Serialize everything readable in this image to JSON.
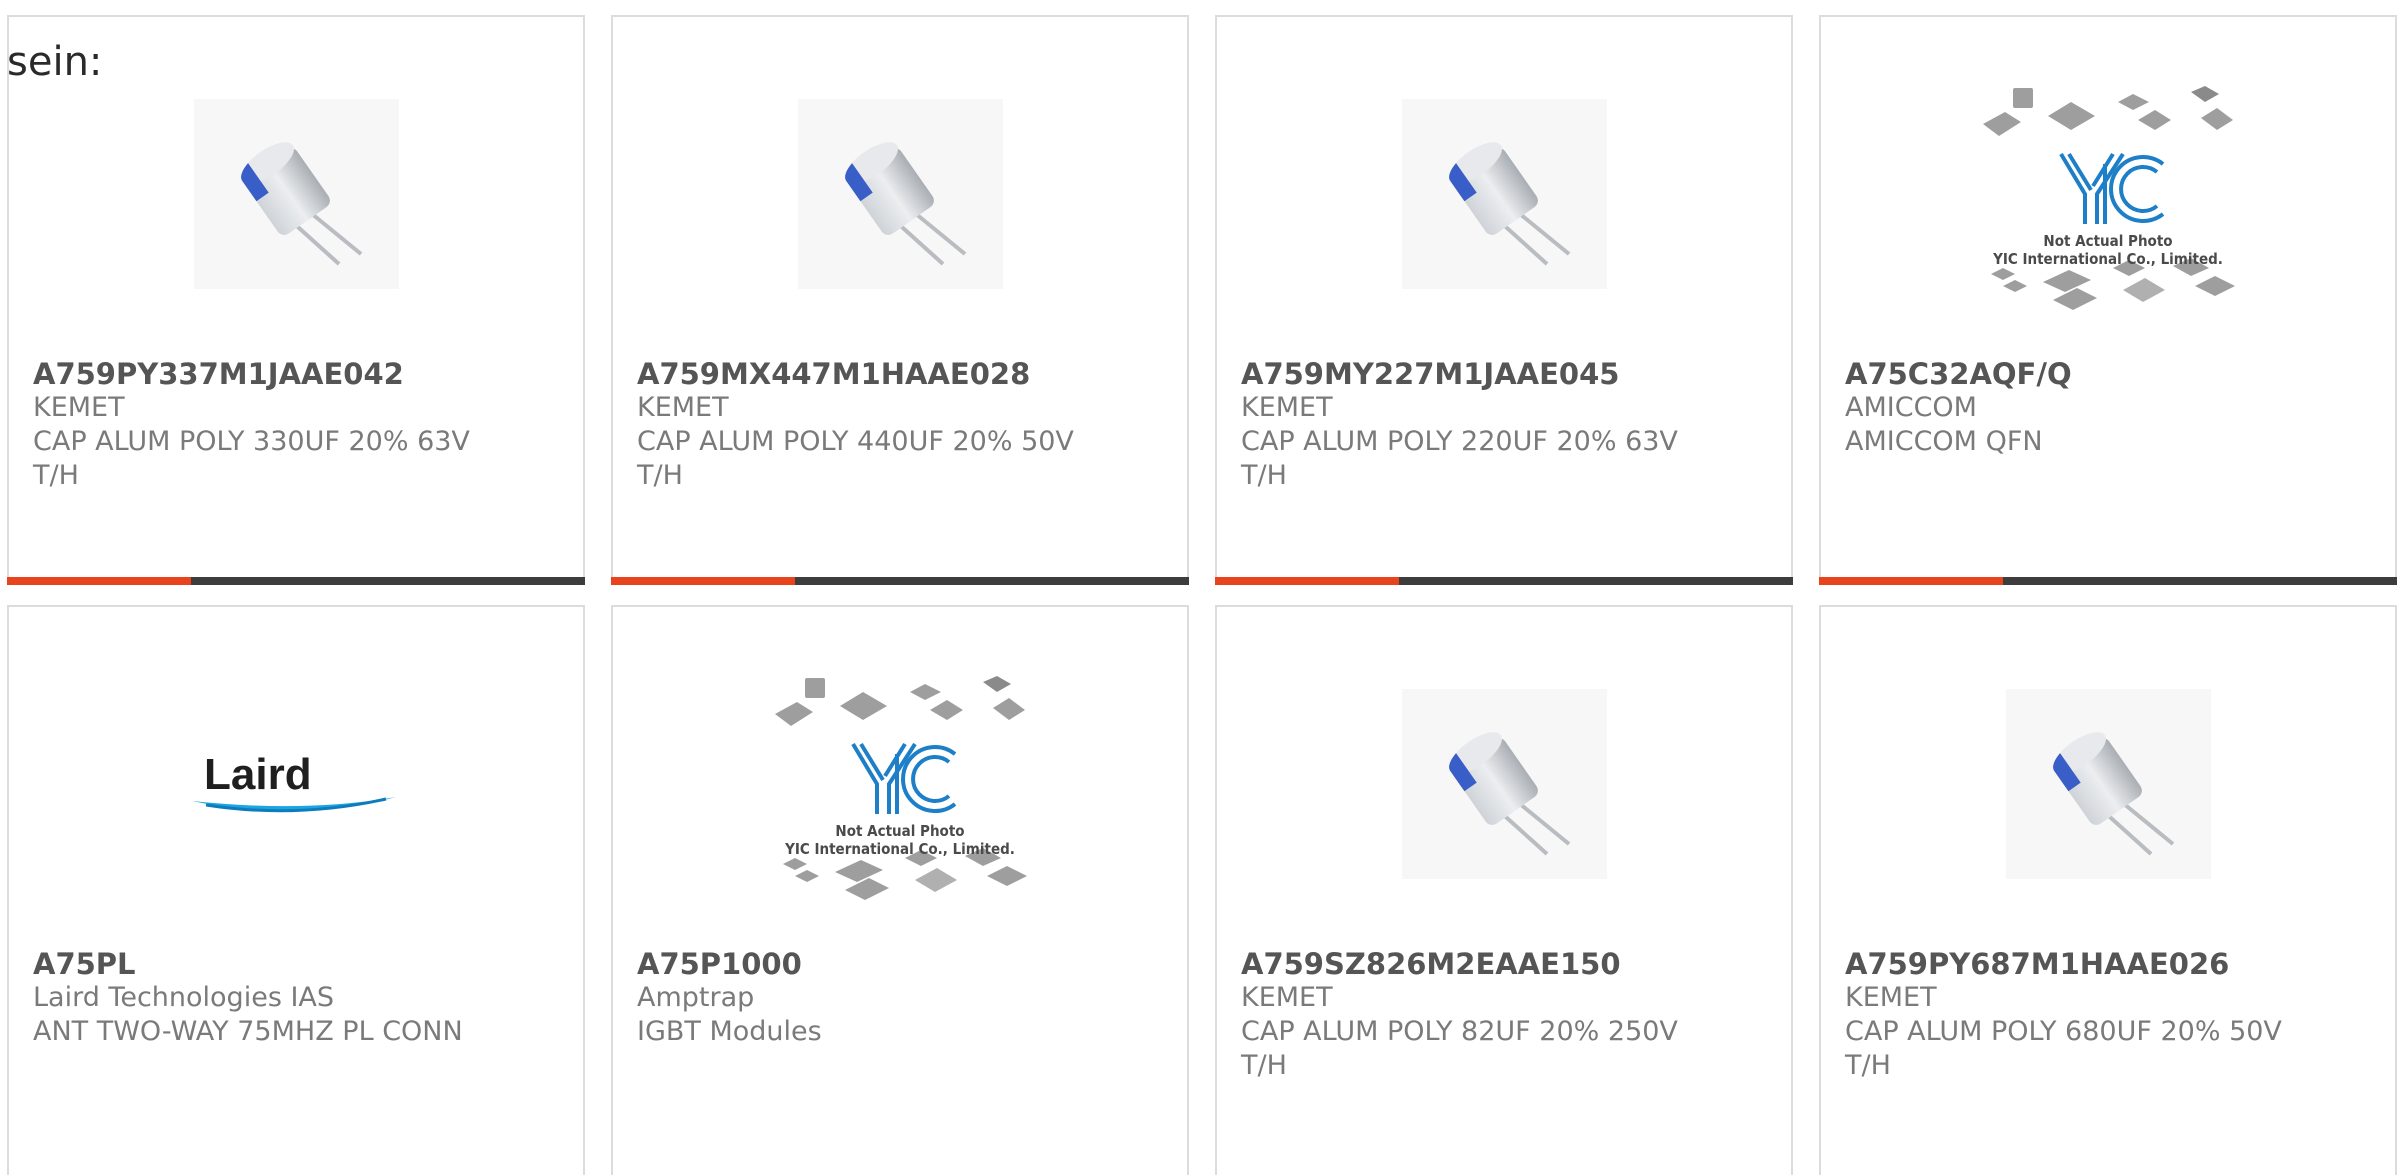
{
  "page_fragment": "sein:",
  "accent_color": "#e8431c",
  "cards": [
    {
      "part": "A759PY337M1JAAE042",
      "mfr": "KEMET",
      "desc": "CAP ALUM POLY 330UF 20% 63V",
      "desc2": "T/H",
      "image": "capacitor"
    },
    {
      "part": "A759MX447M1HAAE028",
      "mfr": "KEMET",
      "desc": "CAP ALUM POLY 440UF 20% 50V",
      "desc2": "T/H",
      "image": "capacitor"
    },
    {
      "part": "A759MY227M1JAAE045",
      "mfr": "KEMET",
      "desc": "CAP ALUM POLY 220UF 20% 63V",
      "desc2": "T/H",
      "image": "capacitor"
    },
    {
      "part": "A75C32AQF/Q",
      "mfr": "AMICCOM",
      "desc": "AMICCOM QFN",
      "desc2": "",
      "image": "placeholder"
    },
    {
      "part": "A75PL",
      "mfr": "Laird Technologies IAS",
      "desc": "ANT TWO-WAY 75MHZ PL CONN",
      "desc2": "",
      "image": "laird-logo"
    },
    {
      "part": "A75P1000",
      "mfr": "Amptrap",
      "desc": "IGBT Modules",
      "desc2": "",
      "image": "placeholder"
    },
    {
      "part": "A759SZ826M2EAAE150",
      "mfr": "KEMET",
      "desc": "CAP ALUM POLY 82UF 20% 250V",
      "desc2": "T/H",
      "image": "capacitor"
    },
    {
      "part": "A759PY687M1HAAE026",
      "mfr": "KEMET",
      "desc": "CAP ALUM POLY 680UF 20% 50V",
      "desc2": "T/H",
      "image": "capacitor"
    }
  ],
  "placeholder": {
    "logo_text": "YIC",
    "caption1": "Not Actual Photo",
    "caption2": "YIC International Co., Limited."
  },
  "laird_logo_text": "Laird"
}
